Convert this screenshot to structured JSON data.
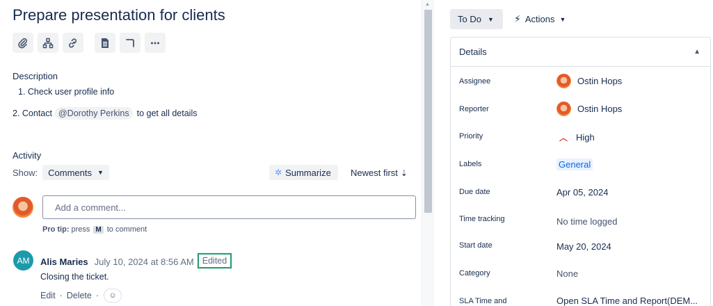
{
  "issue": {
    "title": "Prepare presentation for clients",
    "toolbar_icons": [
      "attachment-icon",
      "child-issue-icon",
      "link-icon",
      "confluence-page-icon",
      "flag-icon",
      "more-icon"
    ]
  },
  "description": {
    "label": "Description",
    "line1": "1. Check user profile info",
    "line2_prefix": "2. Contact",
    "mention": "@Dorothy Perkins",
    "line2_suffix": "to get all details"
  },
  "activity": {
    "label": "Activity",
    "show_label": "Show:",
    "show_value": "Comments",
    "summarize": "Summarize",
    "sort": "Newest first",
    "comment_placeholder": "Add a comment...",
    "protip_bold": "Pro tip:",
    "protip_text1": "press",
    "protip_key": "M",
    "protip_text2": "to comment"
  },
  "comment": {
    "initials": "AM",
    "author": "Alis Maries",
    "date": "July 10, 2024 at 8:56 AM",
    "edited": "Edited",
    "body": "Closing the ticket.",
    "edit": "Edit",
    "delete": "Delete",
    "separator": "·"
  },
  "sidebar": {
    "status": "To Do",
    "actions": "Actions",
    "details_title": "Details",
    "fields": {
      "assignee_label": "Assignee",
      "assignee_value": "Ostin Hops",
      "reporter_label": "Reporter",
      "reporter_value": "Ostin Hops",
      "priority_label": "Priority",
      "priority_value": "High",
      "labels_label": "Labels",
      "labels_value": "General",
      "due_label": "Due date",
      "due_value": "Apr 05, 2024",
      "time_label": "Time tracking",
      "time_value": "No time logged",
      "start_label": "Start date",
      "start_value": "May 20, 2024",
      "category_label": "Category",
      "category_value": "None",
      "sla_label": "SLA Time and",
      "sla_value": "Open SLA Time and Report(DEM..."
    }
  },
  "colors": {
    "edited_highlight": "#22a06b",
    "avatar_am": "#1d9aaa",
    "priority_high": "#e2483d",
    "label_blue": "#0c66e4"
  }
}
